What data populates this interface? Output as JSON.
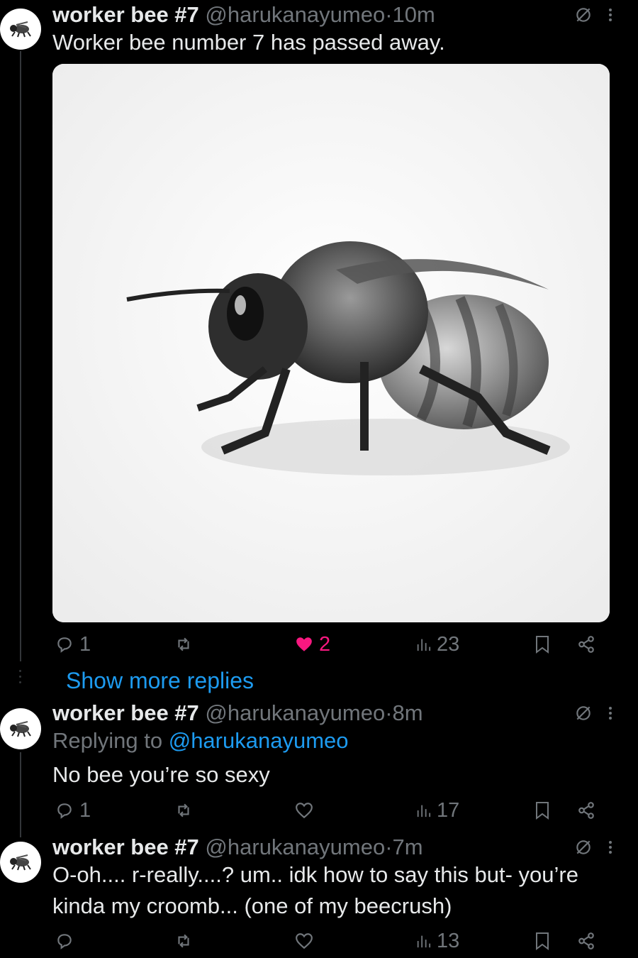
{
  "posts": [
    {
      "name": "worker bee #7",
      "handle": "@harukanayumeo",
      "sep": "·",
      "time": "10m",
      "text": "Worker bee number 7 has passed away.",
      "actions": {
        "replies": "1",
        "reposts": "",
        "likes": "2",
        "views": "23"
      },
      "liked": true,
      "has_media": true
    },
    {
      "name": "worker bee #7",
      "handle": "@harukanayumeo",
      "sep": "·",
      "time": "8m",
      "replying_prefix": "Replying to ",
      "replying_to": "@harukanayumeo",
      "text": "No bee you’re so sexy",
      "actions": {
        "replies": "1",
        "reposts": "",
        "likes": "",
        "views": "17"
      }
    },
    {
      "name": "worker bee #7",
      "handle": "@harukanayumeo",
      "sep": "·",
      "time": "7m",
      "text_line1": "O-oh.... r-really....? um.. idk how to say this but- you’re",
      "text_line2": "kinda my croomb... (one of my beecrush)",
      "actions": {
        "replies": "",
        "reposts": "",
        "likes": "",
        "views": "13"
      }
    }
  ],
  "show_more_replies": "Show more replies",
  "colors": {
    "background": "#000000",
    "text": "#e7e9ea",
    "muted": "#71767b",
    "accent": "#1d9bf0",
    "like": "#f91880"
  },
  "icons": [
    "reply-icon",
    "repost-icon",
    "like-icon",
    "views-icon",
    "bookmark-icon",
    "share-icon",
    "hide-icon",
    "more-icon"
  ]
}
